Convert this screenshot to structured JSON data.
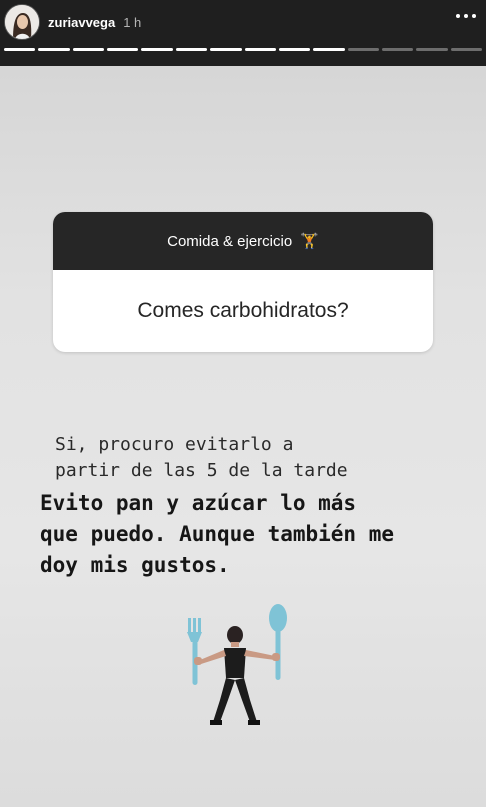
{
  "header": {
    "username": "zuriavvega",
    "time": "1 h"
  },
  "progress": {
    "segments_total": 14,
    "segments_done": 10
  },
  "question_sticker": {
    "title": "Comida & ejercicio",
    "title_emoji": "🏋",
    "question": "Comes carbohidratos?"
  },
  "answer": {
    "line_1": "Si, procuro evitarlo a\npartir de las 5 de la tarde",
    "line_2": "Evito pan y azúcar lo más\nque puedo. Aunque también me\ndoy mis gustos."
  },
  "sticker": {
    "icon": "fork-spoon-dancer-icon"
  },
  "colors": {
    "header_bg": "#1f1f1f",
    "background": "#e2e2e2",
    "question_header": "#262626",
    "utensil": "#7fc3d6"
  }
}
